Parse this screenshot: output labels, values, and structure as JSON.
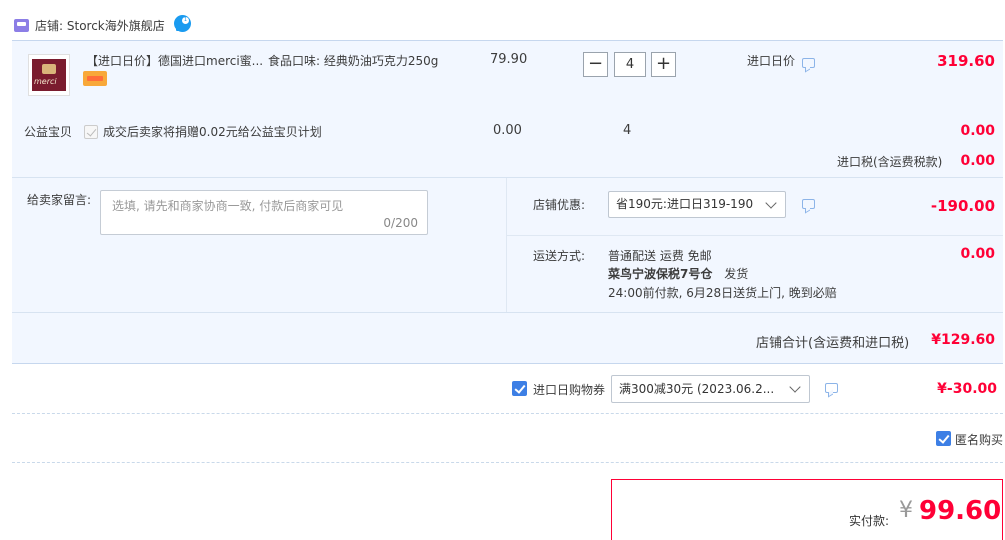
{
  "shop": {
    "label": "店铺:",
    "name": "Storck海外旗舰店",
    "badge": "1"
  },
  "item": {
    "title": "【进口日价】德国进口merci蜜...",
    "sku": "食品口味: 经典奶油巧克力250g",
    "unit_price": "79.90",
    "quantity": "4",
    "qty_minus": "−",
    "qty_plus": "+",
    "import_label": "进口日价",
    "subtotal": "319.60"
  },
  "charity": {
    "label": "公益宝贝",
    "text": "成交后卖家将捐赠0.02元给公益宝贝计划",
    "price": "0.00",
    "quantity": "4",
    "amount": "0.00"
  },
  "tax": {
    "label": "进口税(含运费税款)",
    "amount": "0.00"
  },
  "message": {
    "label": "给卖家留言:",
    "placeholder": "选填, 请先和商家协商一致, 付款后商家可见",
    "count": "0/200"
  },
  "shop_promo": {
    "label": "店铺优惠:",
    "selected": "省190元:进口日319-190",
    "amount": "-190.00"
  },
  "shipping": {
    "label": "运送方式:",
    "line1": "普通配送 运费 免邮",
    "line2_bold": "菜鸟宁波保税7号仓",
    "line2_rest": "发货",
    "line3": "24:00前付款, 6月28日送货上门, 晚到必赔",
    "amount": "0.00"
  },
  "shop_total": {
    "label": "店铺合计(含运费和进口税)",
    "amount": "¥129.60"
  },
  "coupon": {
    "label": "进口日购物券",
    "selected": "满300减30元 (2023.06.2...",
    "amount": "¥-30.00"
  },
  "anonymous": {
    "label": "匿名购买"
  },
  "payment": {
    "label": "实付款:",
    "currency": "¥",
    "amount": "99.60"
  },
  "colors": {
    "accent_red": "#ff0036",
    "panel_bg": "#f2f7ff",
    "checkbox_blue": "#3d7fe5"
  }
}
